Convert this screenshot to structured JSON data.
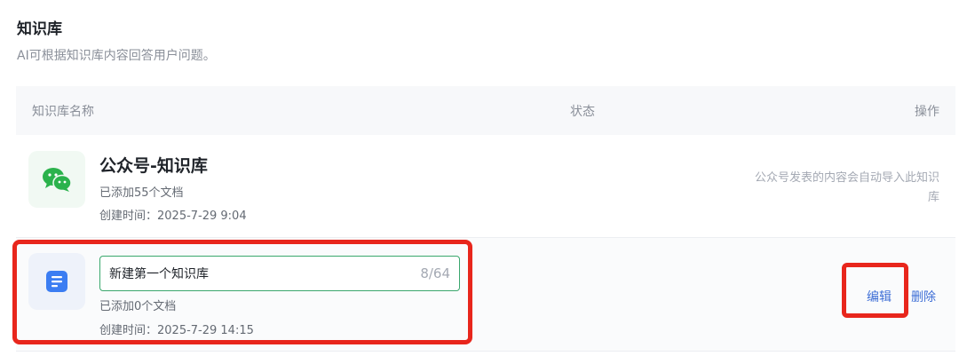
{
  "header": {
    "title": "知识库",
    "subtitle": "AI可根据知识库内容回答用户问题。"
  },
  "table": {
    "columns": {
      "name": "知识库名称",
      "status": "状态",
      "action": "操作"
    },
    "rows": [
      {
        "icon": "wechat-icon",
        "name": "公众号-知识库",
        "doc_count": "已添加55个文档",
        "created": "创建时间：2025-7-29 9:04",
        "note": "公众号发表的内容会自动导入此知识库"
      },
      {
        "icon": "document-icon",
        "name_input_value": "新建第一个知识库",
        "char_count": "8/64",
        "doc_count": "已添加0个文档",
        "created": "创建时间：2025-7-29 14:15",
        "edit_label": "编辑",
        "delete_label": "删除"
      }
    ]
  },
  "colors": {
    "highlight": "#e8261c",
    "link": "#3f6fd6",
    "input_focus": "#3aa76d",
    "wechat_green": "#2bb24c",
    "doc_blue": "#3b7df2"
  }
}
